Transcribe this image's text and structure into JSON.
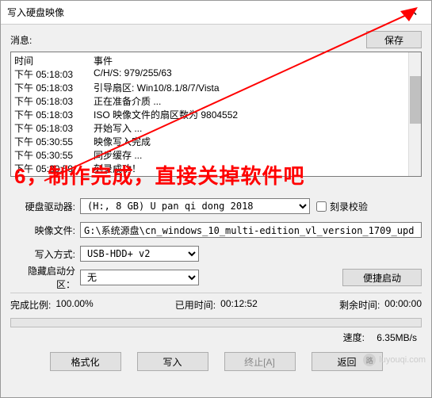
{
  "title": "写入硬盘映像",
  "msg_label": "消息:",
  "save_label": "保存",
  "log": {
    "header_time": "时间",
    "header_event": "事件",
    "rows": [
      {
        "time": "下午 05:18:03",
        "event": "C/H/S: 979/255/63"
      },
      {
        "time": "下午 05:18:03",
        "event": "引导扇区: Win10/8.1/8/7/Vista"
      },
      {
        "time": "下午 05:18:03",
        "event": "正在准备介质 ..."
      },
      {
        "time": "下午 05:18:03",
        "event": "ISO 映像文件的扇区数为 9804552"
      },
      {
        "time": "下午 05:18:03",
        "event": "开始写入 ..."
      },
      {
        "time": "下午 05:30:55",
        "event": "映像写入完成"
      },
      {
        "time": "下午 05:30:55",
        "event": "同步缓存 ..."
      },
      {
        "time": "下午 05:30:59",
        "event": "刻录成功！"
      }
    ]
  },
  "overlay_text": "6，制作完成，直接关掉软件吧",
  "form": {
    "drive_label": "硬盘驱动器:",
    "drive_value": "(H:, 8 GB)       U pan qi dong   2018",
    "verify_label": "刻录校验",
    "image_label": "映像文件:",
    "image_value": "G:\\系统源盘\\cn_windows_10_multi-edition_vl_version_1709_upd",
    "write_mode_label": "写入方式:",
    "write_mode_value": "USB-HDD+ v2",
    "hidden_label": "隐藏启动分区：",
    "hidden_value": "无",
    "portable_btn": "便捷启动"
  },
  "status": {
    "percent_label": "完成比例:",
    "percent_value": "100.00%",
    "elapsed_label": "已用时间:",
    "elapsed_value": "00:12:52",
    "remain_label": "剩余时间:",
    "remain_value": "00:00:00",
    "speed_label": "速度:",
    "speed_value": "6.35MB/s"
  },
  "buttons": {
    "format": "格式化",
    "write": "写入",
    "stop": "终止[A]",
    "back": "返回"
  },
  "watermark": "luyouqi.com"
}
